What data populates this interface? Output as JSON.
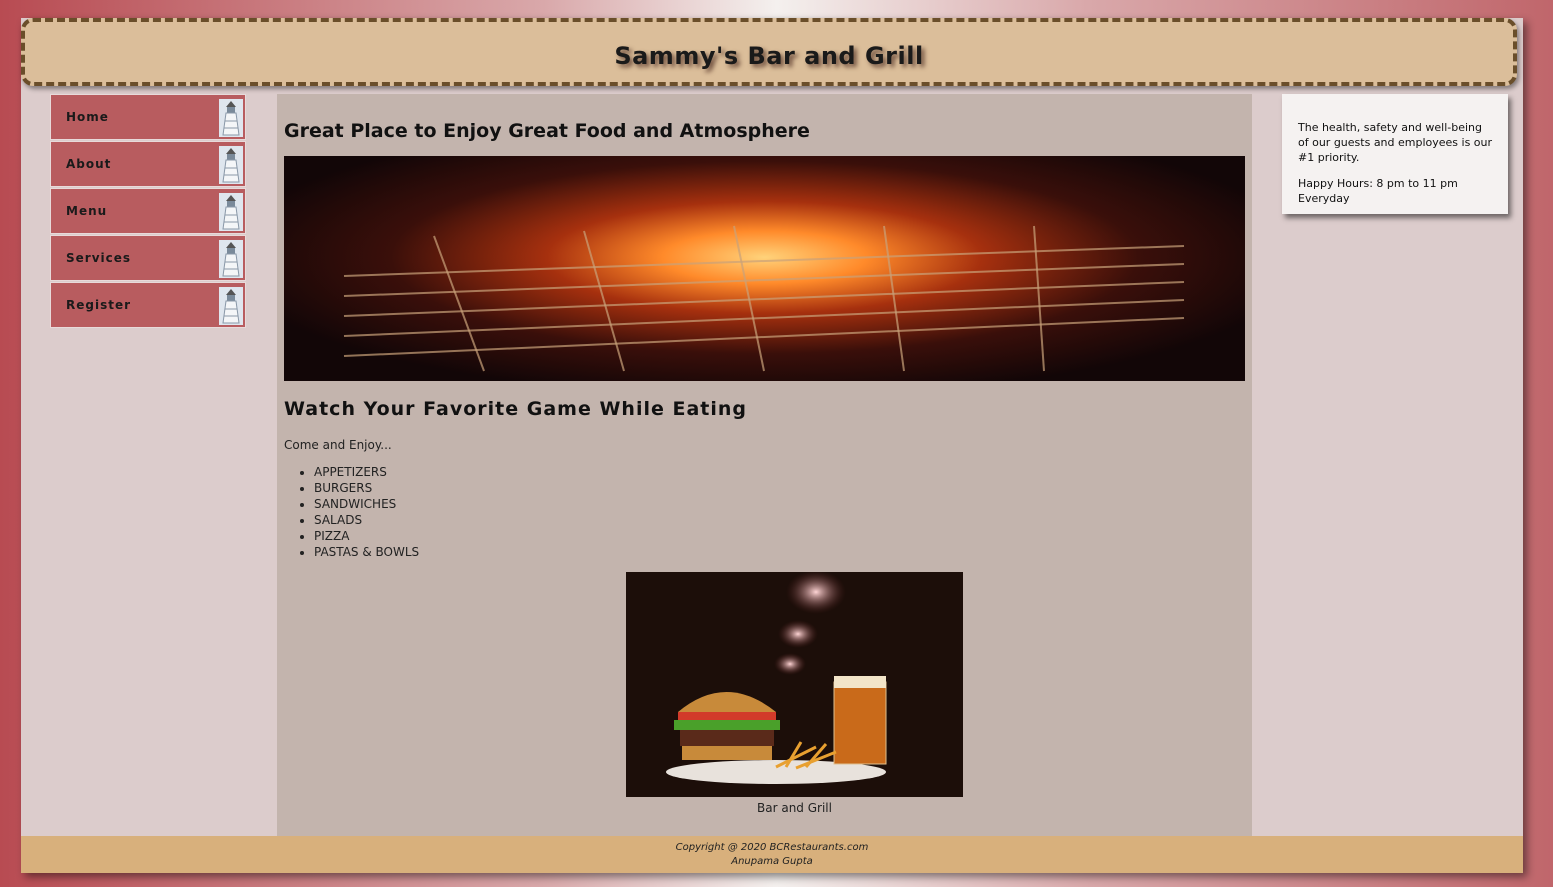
{
  "header": {
    "title": "Sammy's Bar and Grill"
  },
  "nav": {
    "items": [
      {
        "label": "Home"
      },
      {
        "label": "About"
      },
      {
        "label": "Menu"
      },
      {
        "label": "Services"
      },
      {
        "label": "Register"
      }
    ]
  },
  "main": {
    "heading1": "Great Place to Enjoy Great Food and Atmosphere",
    "heading2": "Watch Your Favorite  Game While Eating",
    "intro": "Come and Enjoy...",
    "menu_list": [
      "APPETIZERS",
      "BURGERS",
      "SANDWICHES",
      "SALADS",
      "PIZZA",
      "PASTAS & BOWLS"
    ],
    "image_caption": "Bar and Grill"
  },
  "aside": {
    "notice": "The health, safety and well-being of our guests and employees is our #1 priority.",
    "hours": "Happy Hours: 8 pm to 11 pm Everyday"
  },
  "footer": {
    "copyright": "Copyright @ 2020 BCRestaurants.com",
    "author": "Anupama Gupta"
  },
  "colors": {
    "nav_bg": "#b85c5f",
    "header_bg": "#dbbe9a",
    "main_bg": "#c3b4ad",
    "footer_bg": "#d8b07c"
  }
}
